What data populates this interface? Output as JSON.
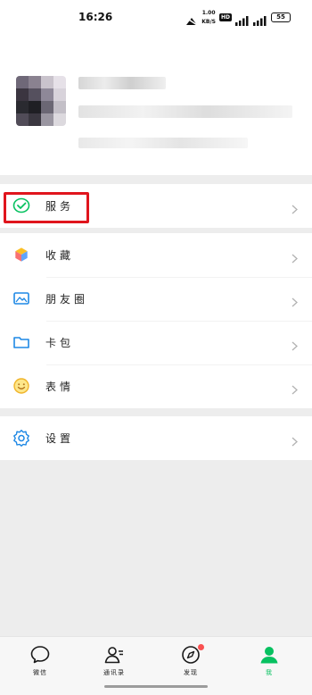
{
  "status_bar": {
    "time": "16:26",
    "network_speed_top": "1.00",
    "network_speed_bottom": "KB/S",
    "hd_badge": "HD",
    "battery": "55",
    "icons": [
      "mute-icon",
      "hd-icon",
      "signal-icon",
      "signal-icon",
      "battery-icon"
    ]
  },
  "profile": {
    "avatar_icon": "pixelated-avatar",
    "name_blurred": true
  },
  "menu": {
    "service_group": [
      {
        "label": "服务",
        "icon": "service-check-icon",
        "highlighted": true
      }
    ],
    "main_group": [
      {
        "label": "收藏",
        "icon": "favorites-cube-icon"
      },
      {
        "label": "朋友圈",
        "icon": "moments-image-icon"
      },
      {
        "label": "卡包",
        "icon": "card-wallet-icon"
      },
      {
        "label": "表情",
        "icon": "sticker-smile-icon"
      }
    ],
    "settings_group": [
      {
        "label": "设置",
        "icon": "settings-gear-icon"
      }
    ]
  },
  "tabbar": {
    "tabs": [
      {
        "label": "微信",
        "icon": "chat-bubble-icon"
      },
      {
        "label": "通讯录",
        "icon": "contacts-icon"
      },
      {
        "label": "发现",
        "icon": "discover-compass-icon",
        "has_badge": true
      },
      {
        "label": "我",
        "icon": "me-person-icon",
        "active": true
      }
    ]
  },
  "colors": {
    "brand_green": "#07c160",
    "highlight_red": "#e0151d",
    "badge_red": "#fa5151",
    "page_background": "#ededed"
  }
}
